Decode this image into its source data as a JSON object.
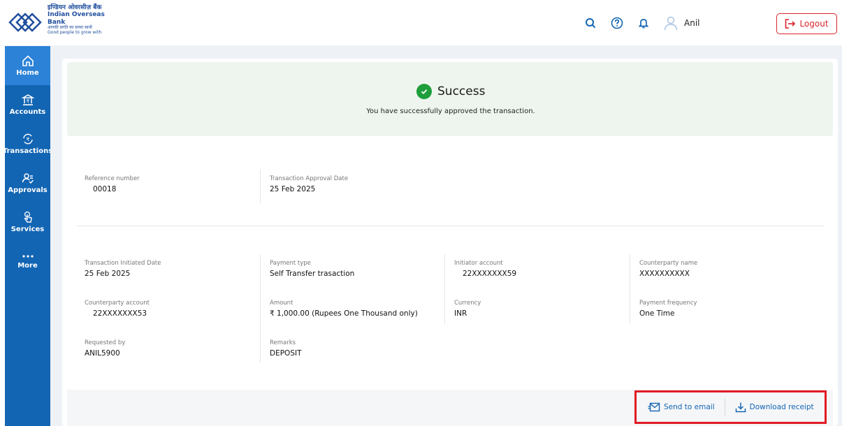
{
  "brand": {
    "name_hindi": "इण्डियन ओवरसीज़ बैंक",
    "name_english": "Indian Overseas Bank",
    "tagline_hindi": "आपकी प्रगति का सच्चा साथी",
    "tagline_english": "Good people to grow with",
    "color": "#1265b3"
  },
  "header": {
    "icons": [
      "search-icon",
      "help-icon",
      "bell-icon",
      "user-avatar-icon"
    ],
    "username": "Anil",
    "logout_label": "Logout"
  },
  "sidebar": {
    "items": [
      {
        "label": "Home",
        "icon": "home-icon",
        "active": true
      },
      {
        "label": "Accounts",
        "icon": "bank-icon"
      },
      {
        "label": "Transactions",
        "icon": "rupee-exchange-icon"
      },
      {
        "label": "Approvals",
        "icon": "approvals-icon"
      },
      {
        "label": "Services",
        "icon": "hand-tap-icon"
      },
      {
        "label": "More",
        "icon": "more-dots-icon"
      }
    ]
  },
  "status": {
    "title": "Success",
    "message": "You have successfully approved the transaction.",
    "color": "#1e9e3a"
  },
  "summary": {
    "reference_label": "Reference number",
    "reference_value": "00018",
    "approval_date_label": "Transaction Approval Date",
    "approval_date_value": "25 Feb 2025"
  },
  "details": {
    "initiated_date_label": "Transaction Initiated Date",
    "initiated_date_value": "25 Feb 2025",
    "payment_type_label": "Payment type",
    "payment_type_value": "Self Transfer trasaction",
    "initiator_account_label": "Initiator account",
    "initiator_account_value": "22XXXXXXX59",
    "counterparty_name_label": "Counterparty name",
    "counterparty_name_value": "XXXXXXXXXX",
    "counterparty_account_label": "Counterparty account",
    "counterparty_account_value": "22XXXXXXX53",
    "amount_label": "Amount",
    "amount_value": "₹ 1,000.00 (Rupees One Thousand  only)",
    "currency_label": "Currency",
    "currency_value": "INR",
    "frequency_label": "Payment frequency",
    "frequency_value": "One Time",
    "requested_by_label": "Requested by",
    "requested_by_value": "ANIL5900",
    "remarks_label": "Remarks",
    "remarks_value": "DEPOSIT"
  },
  "actions": {
    "send_email_label": "Send to email",
    "download_label": "Download receipt"
  }
}
